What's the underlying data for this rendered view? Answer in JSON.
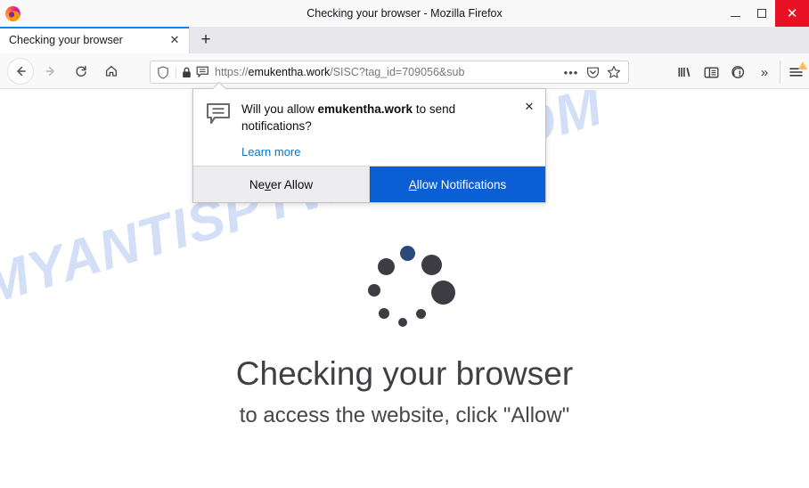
{
  "window": {
    "title": "Checking your browser - Mozilla Firefox",
    "logo_icon": "firefox-logo",
    "controls": {
      "minimize_icon": "minimize-icon",
      "maximize_icon": "maximize-icon",
      "close_icon": "close-icon",
      "close_label": "✕",
      "close_color": "#e81123"
    }
  },
  "tabs": {
    "items": [
      {
        "label": "Checking your browser",
        "close_label": "✕",
        "active": true
      }
    ],
    "new_tab_label": "+",
    "accent_color": "#0a84ff"
  },
  "navigation": {
    "back_icon": "back-arrow-icon",
    "forward_icon": "forward-arrow-icon",
    "reload_icon": "reload-icon",
    "home_icon": "home-icon"
  },
  "urlbar": {
    "shield_icon": "tracking-protection-shield-icon",
    "lock_icon": "padlock-icon",
    "notification_icon": "notification-permission-icon",
    "url_scheme": "https://",
    "url_host": "emukentha.work",
    "url_path": "/SISC?tag_id=709056&sub",
    "page_actions_icon": "ellipsis-icon",
    "page_actions_label": "•••",
    "pocket_icon": "pocket-icon",
    "bookmark_icon": "bookmark-star-icon"
  },
  "toolbar_right": {
    "library_icon": "library-icon",
    "sidebar_icon": "sidebar-icon",
    "account_icon": "account-sync-icon",
    "overflow_icon": "double-chevron-icon",
    "overflow_label": "»",
    "menu_icon": "hamburger-menu-icon",
    "menu_badge_icon": "warning-triangle-icon",
    "menu_badge_color": "#ffbd4f"
  },
  "permission_popup": {
    "icon": "notification-bubble-icon",
    "question_prefix": "Will you allow ",
    "question_host": "emukentha.work",
    "question_suffix": " to send notifications?",
    "learn_more_label": "Learn more",
    "close_icon": "close-icon",
    "close_label": "✕",
    "never_allow_label": "Ne",
    "never_allow_accesskey": "v",
    "never_allow_rest": "er Allow",
    "allow_accesskey": "A",
    "allow_rest": "llow Notifications",
    "primary_color": "#0a5fd4"
  },
  "page": {
    "watermark_text": "MYANTISPYWARE.COM",
    "watermark_color": "#d3dff7",
    "spinner_icon": "loading-spinner-icon",
    "spinner_dot_color": "#3c3c42",
    "spinner_accent_color": "#2b4a7a",
    "headline": "Checking your browser",
    "subtext": "to access the website, click \"Allow\""
  }
}
